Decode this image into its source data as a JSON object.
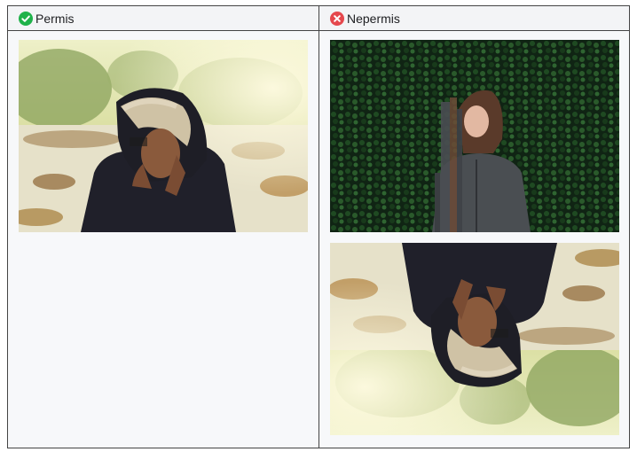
{
  "columns": {
    "allowed": {
      "label": "Permis",
      "icon": "check-circle-icon",
      "icon_color": "#1fb24a"
    },
    "disallowed": {
      "label": "Nepermis",
      "icon": "x-circle-icon",
      "icon_color": "#e5484d"
    }
  },
  "images": {
    "allowed_example": "woman-in-fur-hood-photo",
    "disallowed_distorted": "distorted-woman-in-front-of-ivy-photo",
    "disallowed_upside_down": "upside-down-woman-in-fur-hood-photo"
  }
}
